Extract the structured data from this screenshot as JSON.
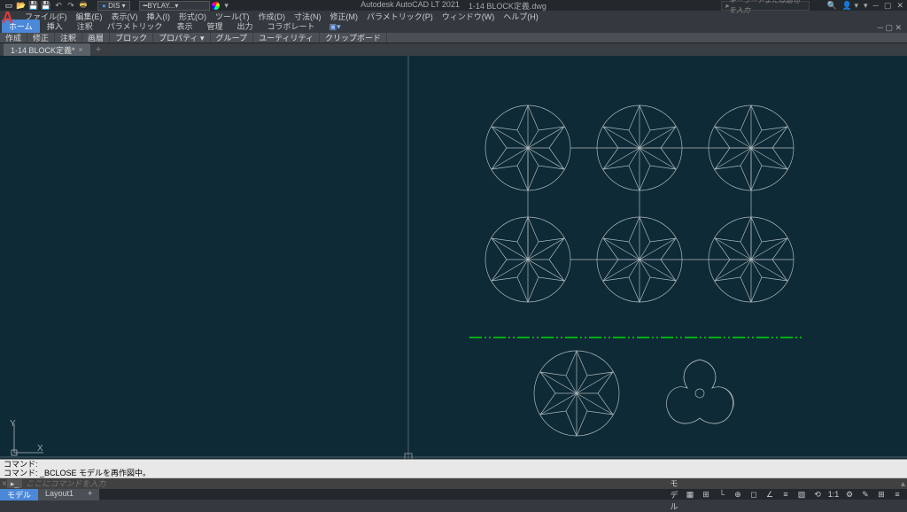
{
  "app": {
    "name": "Autodesk AutoCAD LT 2021",
    "document": "1-14 BLOCK定義.dwg"
  },
  "search": {
    "placeholder": "キーワードまたは語句を入力"
  },
  "qat": {
    "layer_combo1": "DIS",
    "layer_combo2": "BYLAY..."
  },
  "menu": {
    "file": "ファイル(F)",
    "edit": "編集(E)",
    "view": "表示(V)",
    "insert": "挿入(I)",
    "format": "形式(O)",
    "tools": "ツール(T)",
    "draw": "作成(D)",
    "dim": "寸法(N)",
    "modify": "修正(M)",
    "param": "パラメトリック(P)",
    "window": "ウィンドウ(W)",
    "help": "ヘルプ(H)"
  },
  "ribbon_tabs": {
    "home": "ホーム",
    "insert": "挿入",
    "annotate": "注釈",
    "parametric": "パラメトリック",
    "view": "表示",
    "manage": "管理",
    "output": "出力",
    "collab": "コラボレート"
  },
  "ribbon_panels": {
    "draw": "作成",
    "modify": "修正",
    "annot": "注釈",
    "layers": "画層",
    "block": "ブロック",
    "prop": "プロパティ ▾",
    "group": "グループ",
    "util": "ユーティリティ",
    "clip": "クリップボード"
  },
  "file_tab": {
    "name": "1-14 BLOCK定義*"
  },
  "ucs": {
    "y": "Y",
    "x": "X"
  },
  "cmd": {
    "hist1": "コマンド:",
    "hist2": "コマンド: _BCLOSE モデルを再作図中。",
    "prompt": "▸_",
    "placeholder": "ここにコマンドを入力"
  },
  "status": {
    "model": "モデル",
    "layout1": "Layout1",
    "scale": "1:1",
    "plus": "+"
  },
  "chart_data": null
}
